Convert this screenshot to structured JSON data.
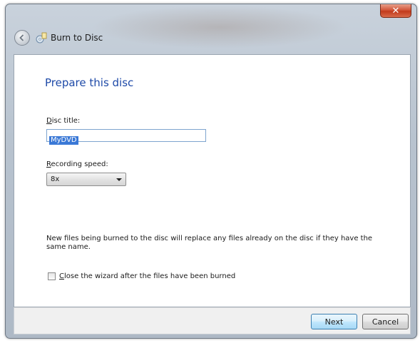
{
  "window": {
    "title": "Burn to Disc",
    "close_symbol": "✕"
  },
  "page": {
    "heading": "Prepare this disc"
  },
  "disc_title": {
    "label_accel": "D",
    "label_rest": "isc title:",
    "value": "MyDVD"
  },
  "recording_speed": {
    "label_accel": "R",
    "label_rest": "ecording speed:",
    "selected": "8x"
  },
  "info": {
    "text": "New files being burned to the disc will replace any files already on the disc if they have the same name."
  },
  "close_option": {
    "label_accel": "C",
    "label_rest": "lose the wizard after the files have been burned",
    "checked": false
  },
  "buttons": {
    "next": "Next",
    "cancel": "Cancel"
  },
  "colors": {
    "heading": "#1e4aa8",
    "selection": "#3a78d6",
    "close_button": "#c23a1c"
  },
  "icons": {
    "back": "back-arrow-icon",
    "app": "burn-disc-icon",
    "dropdown": "chevron-down-icon"
  }
}
